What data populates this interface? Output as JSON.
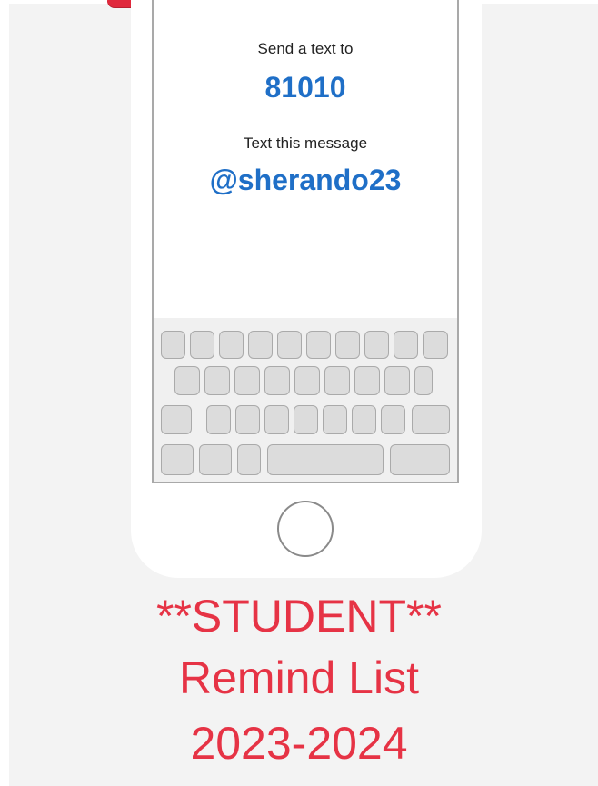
{
  "screen": {
    "send_label": "Send a text to",
    "number": "81010",
    "message_label": "Text this message",
    "code": "@sherando23"
  },
  "caption": {
    "line1": "**STUDENT**",
    "line2": "Remind List",
    "line3": "2023-2024"
  },
  "colors": {
    "accent_blue": "#1f6fc7",
    "caption_red": "#e63345",
    "top_tab_red": "#e0283c"
  },
  "icons": {
    "home_button": "home-button-icon"
  }
}
